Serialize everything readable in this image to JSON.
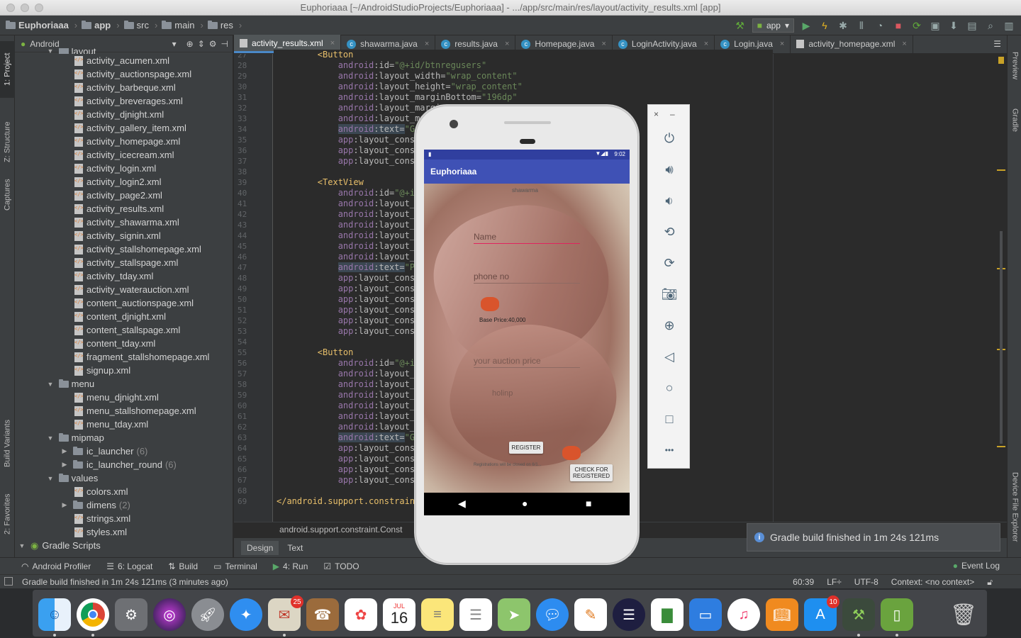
{
  "window": {
    "title": "Euphoriaaa [~/AndroidStudioProjects/Euphoriaaa] - .../app/src/main/res/layout/activity_results.xml [app]"
  },
  "breadcrumbs": [
    "Euphoriaaa",
    "app",
    "src",
    "main",
    "res"
  ],
  "run_config": "app",
  "left_tabs": {
    "project": "1: Project",
    "structure": "Z: Structure",
    "captures": "Captures",
    "build_variants": "Build Variants",
    "favorites": "2: Favorites"
  },
  "right_tabs": {
    "preview": "Preview",
    "gradle": "Gradle",
    "device_file_explorer": "Device File Explorer"
  },
  "project_panel": {
    "view_mode": "Android",
    "partial_folder": "layout",
    "layout_files": [
      "activity_acumen.xml",
      "activity_auctionspage.xml",
      "activity_barbeque.xml",
      "activity_breverages.xml",
      "activity_djnight.xml",
      "activity_gallery_item.xml",
      "activity_homepage.xml",
      "activity_icecream.xml",
      "activity_login.xml",
      "activity_login2.xml",
      "activity_page2.xml",
      "activity_results.xml",
      "activity_shawarma.xml",
      "activity_signin.xml",
      "activity_stallshomepage.xml",
      "activity_stallspage.xml",
      "activity_tday.xml",
      "activity_waterauction.xml",
      "content_auctionspage.xml",
      "content_djnight.xml",
      "content_stallspage.xml",
      "content_tday.xml",
      "fragment_stallshomepage.xml",
      "signup.xml"
    ],
    "menu_folder": "menu",
    "menu_files": [
      "menu_djnight.xml",
      "menu_stallshomepage.xml",
      "menu_tday.xml"
    ],
    "mipmap_folder": "mipmap",
    "mipmap_items": [
      {
        "name": "ic_launcher",
        "count": "(6)"
      },
      {
        "name": "ic_launcher_round",
        "count": "(6)"
      }
    ],
    "values_folder": "values",
    "values_items": [
      {
        "name": "colors.xml",
        "count": ""
      },
      {
        "name": "dimens",
        "count": "(2)"
      },
      {
        "name": "strings.xml",
        "count": ""
      },
      {
        "name": "styles.xml",
        "count": ""
      }
    ],
    "gradle_scripts": "Gradle Scripts"
  },
  "editor_tabs": [
    {
      "label": "activity_results.xml",
      "kind": "xml",
      "active": true
    },
    {
      "label": "shawarma.java",
      "kind": "class",
      "active": false
    },
    {
      "label": "results.java",
      "kind": "class",
      "active": false
    },
    {
      "label": "Homepage.java",
      "kind": "class",
      "active": false
    },
    {
      "label": "LoginActivity.java",
      "kind": "class",
      "active": false
    },
    {
      "label": "Login.java",
      "kind": "class",
      "active": false
    },
    {
      "label": "activity_homepage.xml",
      "kind": "xml",
      "active": false
    }
  ],
  "line_numbers": [
    "27",
    "28",
    "29",
    "30",
    "31",
    "32",
    "33",
    "34",
    "35",
    "36",
    "37",
    "38",
    "39",
    "40",
    "41",
    "42",
    "43",
    "44",
    "45",
    "46",
    "47",
    "48",
    "49",
    "50",
    "51",
    "52",
    "53",
    "54",
    "55",
    "56",
    "57",
    "58",
    "59",
    "60",
    "61",
    "62",
    "63",
    "64",
    "65",
    "66",
    "67",
    "68",
    "69"
  ],
  "code_lines": [
    {
      "ind": "        ",
      "parts": [
        [
          "tag",
          "<Button"
        ]
      ]
    },
    {
      "ind": "            ",
      "parts": [
        [
          "ns",
          "android"
        ],
        [
          "attr",
          ":id="
        ],
        [
          "str",
          "\"@+id/btnregusers\""
        ]
      ]
    },
    {
      "ind": "            ",
      "parts": [
        [
          "ns",
          "android"
        ],
        [
          "attr",
          ":layout_width="
        ],
        [
          "str",
          "\"wrap_content\""
        ]
      ]
    },
    {
      "ind": "            ",
      "parts": [
        [
          "ns",
          "android"
        ],
        [
          "attr",
          ":layout_height="
        ],
        [
          "str",
          "\"wrap_content\""
        ]
      ]
    },
    {
      "ind": "            ",
      "parts": [
        [
          "ns",
          "android"
        ],
        [
          "attr",
          ":layout_marginBottom="
        ],
        [
          "str",
          "\"196dp\""
        ]
      ]
    },
    {
      "ind": "            ",
      "parts": [
        [
          "ns",
          "android"
        ],
        [
          "attr",
          ":layout_marginEn"
        ]
      ]
    },
    {
      "ind": "            ",
      "parts": [
        [
          "ns",
          "android"
        ],
        [
          "attr",
          ":layout_margin"
        ]
      ]
    },
    {
      "ind": "            ",
      "hl": true,
      "parts": [
        [
          "ns",
          "android"
        ],
        [
          "attr",
          ":text="
        ],
        [
          "str",
          "\"Get re"
        ]
      ]
    },
    {
      "ind": "            ",
      "parts": [
        [
          "ns",
          "app"
        ],
        [
          "attr",
          ":layout_constrain"
        ]
      ]
    },
    {
      "ind": "            ",
      "parts": [
        [
          "ns",
          "app"
        ],
        [
          "attr",
          ":layout_constrain"
        ]
      ]
    },
    {
      "ind": "            ",
      "parts": [
        [
          "ns",
          "app"
        ],
        [
          "attr",
          ":layout_constrain"
        ]
      ]
    },
    {
      "ind": "",
      "parts": []
    },
    {
      "ind": "        ",
      "parts": [
        [
          "tag",
          "<TextView"
        ]
      ]
    },
    {
      "ind": "            ",
      "parts": [
        [
          "ns",
          "android"
        ],
        [
          "attr",
          ":id="
        ],
        [
          "str",
          "\"@+id/res"
        ]
      ]
    },
    {
      "ind": "            ",
      "parts": [
        [
          "ns",
          "android"
        ],
        [
          "attr",
          ":layout_width"
        ]
      ]
    },
    {
      "ind": "            ",
      "parts": [
        [
          "ns",
          "android"
        ],
        [
          "attr",
          ":layout_heigh"
        ]
      ]
    },
    {
      "ind": "            ",
      "parts": [
        [
          "ns",
          "android"
        ],
        [
          "attr",
          ":layout_margi"
        ]
      ]
    },
    {
      "ind": "            ",
      "parts": [
        [
          "ns",
          "android"
        ],
        [
          "attr",
          ":layout_margi"
        ]
      ]
    },
    {
      "ind": "            ",
      "parts": [
        [
          "ns",
          "android"
        ],
        [
          "attr",
          ":layout_margi"
        ]
      ]
    },
    {
      "ind": "            ",
      "parts": [
        [
          "ns",
          "android"
        ],
        [
          "attr",
          ":layout_margi"
        ]
      ]
    },
    {
      "ind": "            ",
      "hl": true,
      "parts": [
        [
          "ns",
          "android"
        ],
        [
          "attr",
          ":text="
        ],
        [
          "str",
          "\"Pranay"
        ]
      ]
    },
    {
      "ind": "            ",
      "parts": [
        [
          "ns",
          "app"
        ],
        [
          "attr",
          ":layout_constrain"
        ]
      ]
    },
    {
      "ind": "            ",
      "parts": [
        [
          "ns",
          "app"
        ],
        [
          "attr",
          ":layout_constrain"
        ]
      ]
    },
    {
      "ind": "            ",
      "parts": [
        [
          "ns",
          "app"
        ],
        [
          "attr",
          ":layout_constrain"
        ]
      ]
    },
    {
      "ind": "            ",
      "parts": [
        [
          "ns",
          "app"
        ],
        [
          "attr",
          ":layout_constrain"
        ]
      ]
    },
    {
      "ind": "            ",
      "parts": [
        [
          "ns",
          "app"
        ],
        [
          "attr",
          ":layout_constrain"
        ]
      ]
    },
    {
      "ind": "            ",
      "parts": [
        [
          "ns",
          "app"
        ],
        [
          "attr",
          ":layout_constrain"
        ]
      ]
    },
    {
      "ind": "",
      "parts": []
    },
    {
      "ind": "        ",
      "parts": [
        [
          "tag",
          "<Button"
        ]
      ]
    },
    {
      "ind": "            ",
      "parts": [
        [
          "ns",
          "android"
        ],
        [
          "attr",
          ":id="
        ],
        [
          "str",
          "\"@+id/bac"
        ]
      ]
    },
    {
      "ind": "            ",
      "parts": [
        [
          "ns",
          "android"
        ],
        [
          "attr",
          ":layout_width"
        ]
      ]
    },
    {
      "ind": "            ",
      "parts": [
        [
          "ns",
          "android"
        ],
        [
          "attr",
          ":layout_heigh"
        ]
      ]
    },
    {
      "ind": "            ",
      "parts": [
        [
          "ns",
          "android"
        ],
        [
          "attr",
          ":layout_margi"
        ]
      ]
    },
    {
      "ind": "            ",
      "parts": [
        [
          "ns",
          "android"
        ],
        [
          "attr",
          ":layout_margi"
        ]
      ]
    },
    {
      "ind": "            ",
      "parts": [
        [
          "ns",
          "android"
        ],
        [
          "attr",
          ":layout_margi"
        ]
      ]
    },
    {
      "ind": "            ",
      "parts": [
        [
          "ns",
          "android"
        ],
        [
          "attr",
          ":layout_margi"
        ]
      ]
    },
    {
      "ind": "            ",
      "hl": true,
      "parts": [
        [
          "ns",
          "android"
        ],
        [
          "attr",
          ":text="
        ],
        [
          "str",
          "\"Go bac"
        ]
      ]
    },
    {
      "ind": "            ",
      "parts": [
        [
          "ns",
          "app"
        ],
        [
          "attr",
          ":layout_constrain"
        ]
      ]
    },
    {
      "ind": "            ",
      "parts": [
        [
          "ns",
          "app"
        ],
        [
          "attr",
          ":layout_constrain"
        ]
      ]
    },
    {
      "ind": "            ",
      "parts": [
        [
          "ns",
          "app"
        ],
        [
          "attr",
          ":layout_constrain"
        ]
      ]
    },
    {
      "ind": "            ",
      "parts": [
        [
          "ns",
          "app"
        ],
        [
          "attr",
          ":layout_constrain"
        ]
      ]
    },
    {
      "ind": "",
      "parts": []
    },
    {
      "ind": "",
      "parts": [
        [
          "tag",
          "</android.support.constraint"
        ]
      ]
    }
  ],
  "editor_breadcrumb": "android.support.constraint.Const",
  "design_tabs": {
    "design": "Design",
    "text": "Text"
  },
  "phone": {
    "status_time": "9:02",
    "app_title": "Euphoriaaa",
    "screen_label": "shawarma",
    "name_hint": "Name",
    "phone_hint": "phone no",
    "base_price": "Base Price:40,000",
    "auction_hint": "your auction price",
    "extra_hint": "holinp",
    "register_label": "REGISTER",
    "closing_note": "Registrations will be closed on 6/1...",
    "check_label_1": "CHECK FOR",
    "check_label_2": "REGISTERED"
  },
  "emulator": {
    "close": "×",
    "minimize": "–",
    "more": "•••"
  },
  "notification": "Gradle build finished in 1m 24s 121ms",
  "bottom_tools": [
    {
      "label": "Android Profiler",
      "icon": "profiler-icon"
    },
    {
      "label": "6: Logcat",
      "icon": "logcat-icon"
    },
    {
      "label": "Build",
      "icon": "build-icon"
    },
    {
      "label": "Terminal",
      "icon": "terminal-icon"
    },
    {
      "label": "4: Run",
      "icon": "run-icon"
    },
    {
      "label": "TODO",
      "icon": "todo-icon"
    }
  ],
  "event_log": "Event Log",
  "status": {
    "message": "Gradle build finished in 1m 24s 121ms (3 minutes ago)",
    "position": "60:39",
    "line_sep": "LF÷",
    "encoding": "UTF-8",
    "context": "Context: <no context>"
  },
  "dock": {
    "mail_badge": "25",
    "calendar_month": "JUL",
    "calendar_day": "16",
    "appstore_badge": "10"
  },
  "colors": {
    "accent": "#4a88c7",
    "app_primary": "#3f51b5",
    "app_primary_dark": "#303f9f"
  }
}
